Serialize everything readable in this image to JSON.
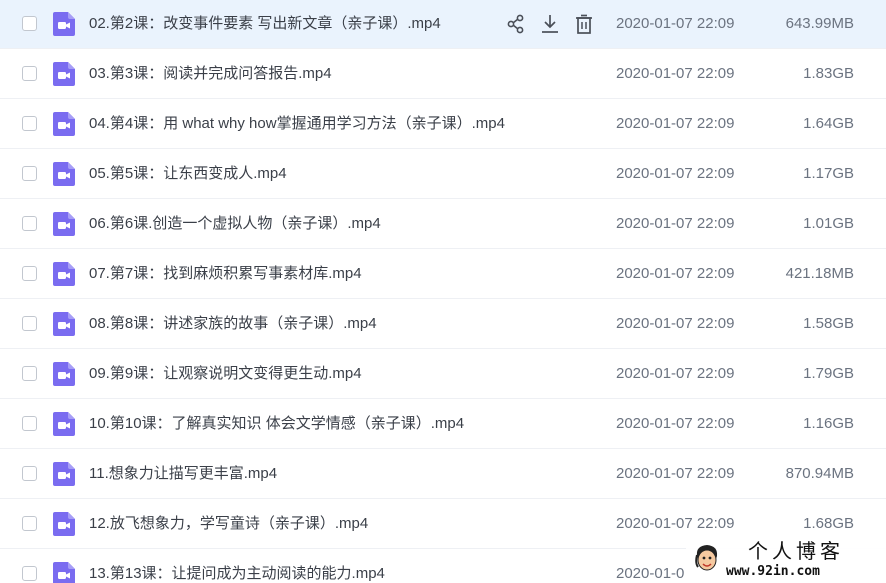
{
  "files": [
    {
      "name": "02.第2课：改变事件要素 写出新文章（亲子课）.mp4",
      "date": "2020-01-07 22:09",
      "size": "643.99MB",
      "hovered": true
    },
    {
      "name": "03.第3课：阅读并完成问答报告.mp4",
      "date": "2020-01-07 22:09",
      "size": "1.83GB"
    },
    {
      "name": "04.第4课：用 what why  how掌握通用学习方法（亲子课）.mp4",
      "date": "2020-01-07 22:09",
      "size": "1.64GB"
    },
    {
      "name": "05.第5课：让东西变成人.mp4",
      "date": "2020-01-07 22:09",
      "size": "1.17GB"
    },
    {
      "name": "06.第6课.创造一个虚拟人物（亲子课）.mp4",
      "date": "2020-01-07 22:09",
      "size": "1.01GB"
    },
    {
      "name": "07.第7课：找到麻烦积累写事素材库.mp4",
      "date": "2020-01-07 22:09",
      "size": "421.18MB"
    },
    {
      "name": "08.第8课：讲述家族的故事（亲子课）.mp4",
      "date": "2020-01-07 22:09",
      "size": "1.58GB"
    },
    {
      "name": "09.第9课：让观察说明文变得更生动.mp4",
      "date": "2020-01-07 22:09",
      "size": "1.79GB"
    },
    {
      "name": "10.第10课：了解真实知识 体会文学情感（亲子课）.mp4",
      "date": "2020-01-07 22:09",
      "size": "1.16GB"
    },
    {
      "name": "11.想象力让描写更丰富.mp4",
      "date": "2020-01-07 22:09",
      "size": "870.94MB"
    },
    {
      "name": "12.放飞想象力，学写童诗（亲子课）.mp4",
      "date": "2020-01-07 22:09",
      "size": "1.68GB"
    },
    {
      "name": "13.第13课：让提问成为主动阅读的能力.mp4",
      "date": "2020-01-0",
      "size": ""
    }
  ],
  "row_actions": [
    "share-icon",
    "download-icon",
    "delete-icon"
  ],
  "watermark": {
    "title": "个人博客",
    "url": "www.92in.com"
  },
  "colors": {
    "accent": "#7a6cf0",
    "hover_row": "#eaf3fd"
  }
}
